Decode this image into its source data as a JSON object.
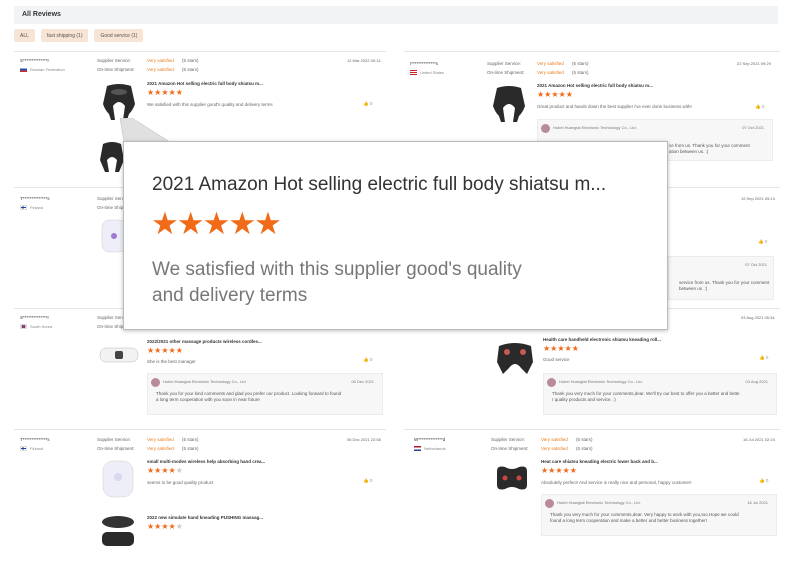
{
  "header": {
    "title": "All Reviews"
  },
  "filters": [
    {
      "label": "ALL"
    },
    {
      "label": "fast shipping (1)"
    },
    {
      "label": "Good service (1)"
    }
  ],
  "labels": {
    "supplier_service": "Supplier Service:",
    "ontime_shipment": "On-time Shipment:",
    "very_satisfied": "Very satisfied",
    "five_stars": "(5 stars)"
  },
  "reviews": {
    "r1": {
      "user": "S**************r",
      "country": "Russian Federation",
      "date": "12 Mar 2022 00:14",
      "product": "2021 Amazon Hot selling electric full body shiatsu m...",
      "product2": "2021 Amazon Hot selling electric full body shiatsu m...",
      "rating": 5,
      "comment": "We satisfied with this supplier good's quality and delivery terms",
      "likes": "0"
    },
    "r2": {
      "user": "I**************s",
      "country": "United States",
      "date": "22 Sep 2021 09:29",
      "product": "2021 Amazon Hot selling electric full body shiatsu m...",
      "rating": 5,
      "comment": "Great product and hands down the best supplier i've ever done business with!",
      "likes": "0",
      "reply_name": "Hubei Huangtai Electronic Technology Co., Ltd.",
      "reply_date": "07 Oct 2021",
      "reply_text_1": "ce from us. Thank you for your comment",
      "reply_text_2": "ation between us. :)"
    },
    "r3": {
      "user": "T**************s",
      "country": "Finland",
      "date": "19 Sep 2021 05:13",
      "likes": "0",
      "reply_date": "07 Oct 2021",
      "reply_text_1": "service from us. Thank you for your comment",
      "reply_text_2": "between us. :)"
    },
    "r4": {
      "user": "S**************r",
      "country": "South Korea",
      "date": "03 Aug 2021 05:34",
      "product": "2022/2021 other massage products wireless cordles...",
      "rating": 5,
      "comment": "She is the best manager",
      "likes": "0",
      "reply_name": "Hubei Huangtai Electronic Technology Co., Ltd",
      "reply_date": "06 Dec 2021",
      "reply_text_1": "Thank you for your kind comments and glad you prefer our product. Looking forward to found",
      "reply_text_2": "a long term cooperation with you soon in near future"
    },
    "r5": {
      "product": "Health care handheld electronic shiatsu kneading roll...",
      "rating": 5,
      "comment": "Good service",
      "likes": "0",
      "reply_name": "Hubei Huangtai Electronic Technology Co., Ltd.",
      "reply_date": "03 Aug 2021",
      "reply_text_1": "Thank you very much for your comments,dear. We'll try our best to offer you a better and bette",
      "reply_text_2": "r quality products and service. :)"
    },
    "r6": {
      "user": "T**************s",
      "country": "Finland",
      "date": "06 Dec 2021 22:58",
      "product": "small multi-modes wireless help absorbing hand crea...",
      "rating": 4,
      "comment": "seems to be good quality product",
      "likes": "0",
      "product2": "2022 new simulate hand kneading PUSHING massag...",
      "rating2": 4
    },
    "r7": {
      "user": "W**************d",
      "country": "Netherlands",
      "date": "16 Jul 2021 02:24",
      "product": "Heat care shiatsu kneading electric lower back and b...",
      "rating": 5,
      "comment": "Absolutely perfect! And service is really nice and personal, happy customer!",
      "likes": "0",
      "reply_name": "Hubei Huangtai Electronic Technology Co., Ltd.",
      "reply_date": "16 Jul 2021",
      "reply_text_1": "Thank you very much for your comments,dear. Very happy to work with you,too.Hope we could",
      "reply_text_2": "found a long term cooperation and make a better and better business together!"
    }
  },
  "zoom": {
    "title": "2021 Amazon Hot selling electric full body shiatsu m...",
    "rating": 5,
    "text": "We satisfied with this supplier good's quality and delivery terms"
  },
  "colors": {
    "accent": "#f06a18",
    "link": "#e97c1e"
  }
}
